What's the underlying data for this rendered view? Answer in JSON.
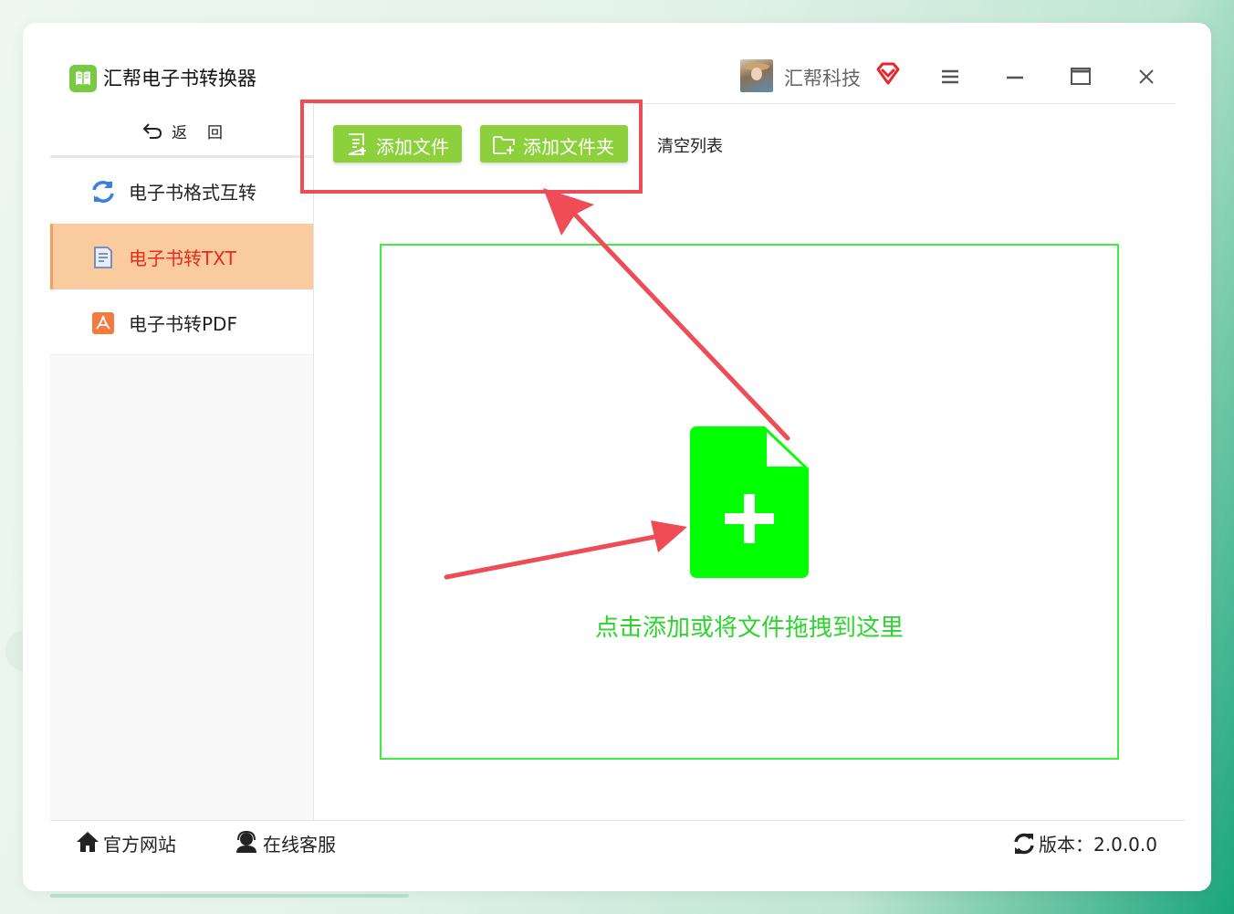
{
  "app": {
    "title": "汇帮电子书转换器"
  },
  "user": {
    "name": "汇帮科技"
  },
  "sidebar": {
    "back_label": "返回",
    "items": [
      {
        "label": "电子书格式互转",
        "icon": "sync-icon",
        "active": false
      },
      {
        "label": "电子书转TXT",
        "icon": "txt-doc-icon",
        "active": true
      },
      {
        "label": "电子书转PDF",
        "icon": "pdf-icon",
        "active": false
      }
    ]
  },
  "toolbar": {
    "add_file_label": "添加文件",
    "add_folder_label": "添加文件夹",
    "clear_label": "清空列表"
  },
  "drop_zone": {
    "hint": "点击添加或将文件拖拽到这里"
  },
  "footer": {
    "site_label": "官方网站",
    "service_label": "在线客服",
    "version_label": "版本：2.0.0.0"
  },
  "colors": {
    "accent_green": "#8cd13c",
    "drop_green": "#00ff00",
    "highlight_red": "#ee4d58",
    "active_bg": "#fbcba0",
    "active_text": "#e52b1a"
  }
}
